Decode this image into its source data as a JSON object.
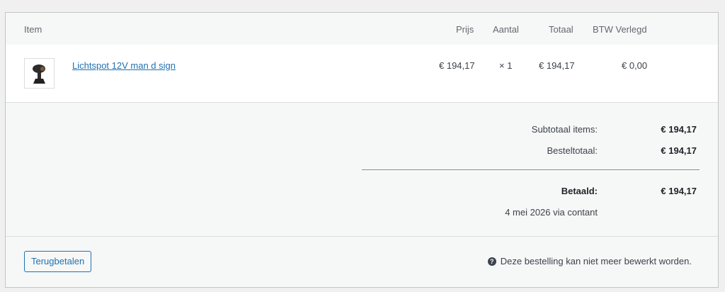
{
  "table": {
    "headers": {
      "item": "Item",
      "price": "Prijs",
      "qty": "Aantal",
      "total": "Totaal",
      "vat": "BTW Verlegd"
    },
    "rows": [
      {
        "name": "Lichtspot 12V man d sign",
        "thumb_icon": "spotlight-product-icon",
        "price": "€ 194,17",
        "qty": "× 1",
        "total": "€ 194,17",
        "vat": "€ 0,00"
      }
    ]
  },
  "totals": {
    "subtotal_label": "Subtotaal items:",
    "subtotal_value": "€ 194,17",
    "order_total_label": "Besteltotaal:",
    "order_total_value": "€ 194,17",
    "paid_label": "Betaald:",
    "paid_value": "€ 194,17",
    "paid_note": "4 mei 2026 via contant"
  },
  "footer": {
    "refund_label": "Terugbetalen",
    "notice_icon": "help-icon",
    "notice_text": "Deze bestelling kan niet meer bewerkt worden."
  },
  "colors": {
    "link": "#2271b1",
    "panel_bg": "#f6f7f7",
    "row_bg": "#ffffff"
  }
}
